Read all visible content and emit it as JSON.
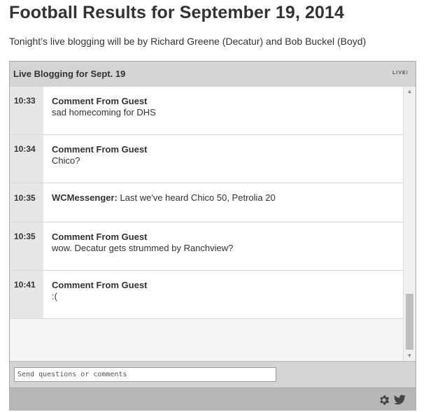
{
  "page": {
    "title": "Football Results for September 19, 2014",
    "subtitle": "Tonight’s live blogging will be by Richard Greene (Decatur) and Bob Buckel (Boyd)"
  },
  "widget": {
    "title": "Live Blogging for Sept. 19",
    "badge": "LIVE!",
    "entries": [
      {
        "time": "10:33",
        "author": "Comment From Guest",
        "message": "sad homecoming for DHS"
      },
      {
        "time": "10:34",
        "author": "Comment From Guest",
        "message": "Chico?"
      },
      {
        "time": "10:35",
        "author": "WCMessenger:",
        "message": " Last we've heard Chico 50, Petrolia 20"
      },
      {
        "time": "10:35",
        "author": "Comment From Guest",
        "message": "wow. Decatur gets strummed by Ranchview?"
      },
      {
        "time": "10:41",
        "author": "Comment From Guest",
        "message": ":("
      }
    ],
    "compose": {
      "placeholder": "Send questions or comments"
    },
    "footer": {
      "icons": [
        "gear-icon",
        "twitter-icon"
      ]
    }
  }
}
